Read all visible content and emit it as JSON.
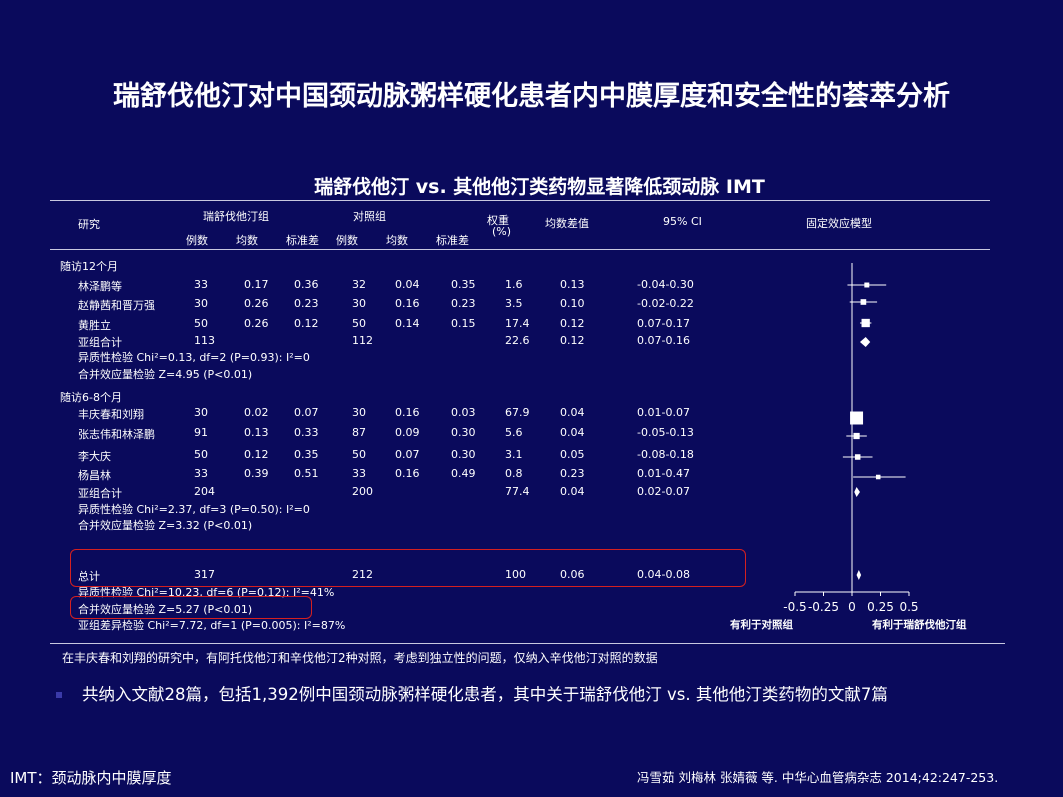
{
  "title": "瑞舒伐他汀对中国颈动脉粥样硬化患者内中膜厚度和安全性的荟萃分析",
  "subtitle": "瑞舒伐他汀 vs. 其他他汀类药物显著降低颈动脉 IMT",
  "table": {
    "col_study": "研究",
    "group1": "瑞舒伐他汀组",
    "group2": "对照组",
    "weight": "权重",
    "weight_unit": "(%)",
    "md": "均数差值",
    "ci": "95% CI",
    "model": "固定效应模型",
    "sub_n1": "例数",
    "sub_mean1": "均数",
    "sub_sd1": "标准差",
    "sub_n2": "例数",
    "sub_mean2": "均数",
    "sub_sd2": "标准差"
  },
  "sections": {
    "s1": "随访12个月",
    "s1_het": "异质性检验 Chi²=0.13, df=2 (P=0.93): I²=0",
    "s1_overall": "合并效应量检验 Z=4.95 (P<0.01)",
    "s2": "随访6-8个月",
    "s2_het": "异质性检验 Chi²=2.37, df=3 (P=0.50): I²=0",
    "s2_overall": "合并效应量检验 Z=3.32 (P<0.01)",
    "total_het": "异质性检验 Chi²=10.23, df=6 (P=0.12): I²=41%",
    "total_overall": "合并效应量检验 Z=5.27 (P<0.01)",
    "subgroup_diff": "亚组差异检验 Chi²=7.72, df=1 (P=0.005): I²=87%"
  },
  "chart_data": {
    "type": "forest",
    "rows": [
      {
        "study": "林泽鹏等",
        "n1": "33",
        "m1": "0.17",
        "sd1": "0.36",
        "n2": "32",
        "m2": "0.04",
        "sd2": "0.35",
        "w": "1.6",
        "md": "0.13",
        "ci": "-0.04-0.30",
        "est": 0.13,
        "lo": -0.04,
        "hi": 0.3,
        "kind": "study"
      },
      {
        "study": "赵静茜和晋万强",
        "n1": "30",
        "m1": "0.26",
        "sd1": "0.23",
        "n2": "30",
        "m2": "0.16",
        "sd2": "0.23",
        "w": "3.5",
        "md": "0.10",
        "ci": "-0.02-0.22",
        "est": 0.1,
        "lo": -0.02,
        "hi": 0.22,
        "kind": "study"
      },
      {
        "study": "黄胜立",
        "n1": "50",
        "m1": "0.26",
        "sd1": "0.12",
        "n2": "50",
        "m2": "0.14",
        "sd2": "0.15",
        "w": "17.4",
        "md": "0.12",
        "ci": "0.07-0.17",
        "est": 0.12,
        "lo": 0.07,
        "hi": 0.17,
        "kind": "study"
      },
      {
        "study": "亚组合计",
        "n1": "113",
        "m1": "",
        "sd1": "",
        "n2": "112",
        "m2": "",
        "sd2": "",
        "w": "22.6",
        "md": "0.12",
        "ci": "0.07-0.16",
        "est": 0.12,
        "lo": 0.07,
        "hi": 0.16,
        "kind": "subtotal"
      },
      {
        "study": "丰庆春和刘翔",
        "n1": "30",
        "m1": "0.02",
        "sd1": "0.07",
        "n2": "30",
        "m2": "0.16",
        "sd2": "0.03",
        "w": "67.9",
        "md": "0.04",
        "ci": "0.01-0.07",
        "est": 0.04,
        "lo": 0.01,
        "hi": 0.07,
        "kind": "study"
      },
      {
        "study": "张志伟和林泽鹏",
        "n1": "91",
        "m1": "0.13",
        "sd1": "0.33",
        "n2": "87",
        "m2": "0.09",
        "sd2": "0.30",
        "w": "5.6",
        "md": "0.04",
        "ci": "-0.05-0.13",
        "est": 0.04,
        "lo": -0.05,
        "hi": 0.13,
        "kind": "study"
      },
      {
        "study": "李大庆",
        "n1": "50",
        "m1": "0.12",
        "sd1": "0.35",
        "n2": "50",
        "m2": "0.07",
        "sd2": "0.30",
        "w": "3.1",
        "md": "0.05",
        "ci": "-0.08-0.18",
        "est": 0.05,
        "lo": -0.08,
        "hi": 0.18,
        "kind": "study"
      },
      {
        "study": "杨昌林",
        "n1": "33",
        "m1": "0.39",
        "sd1": "0.51",
        "n2": "33",
        "m2": "0.16",
        "sd2": "0.49",
        "w": "0.8",
        "md": "0.23",
        "ci": "0.01-0.47",
        "est": 0.23,
        "lo": 0.01,
        "hi": 0.47,
        "kind": "study"
      },
      {
        "study": "亚组合计",
        "n1": "204",
        "m1": "",
        "sd1": "",
        "n2": "200",
        "m2": "",
        "sd2": "",
        "w": "77.4",
        "md": "0.04",
        "ci": "0.02-0.07",
        "est": 0.04,
        "lo": 0.02,
        "hi": 0.07,
        "kind": "subtotal"
      },
      {
        "study": "总计",
        "n1": "317",
        "m1": "",
        "sd1": "",
        "n2": "212",
        "m2": "",
        "sd2": "",
        "w": "100",
        "md": "0.06",
        "ci": "0.04-0.08",
        "est": 0.06,
        "lo": 0.04,
        "hi": 0.08,
        "kind": "total"
      }
    ],
    "x_ticks": [
      "-0.5",
      "-0.25",
      "0",
      "0.25",
      "0.5"
    ],
    "x_tick_values": [
      -0.5,
      -0.25,
      0,
      0.25,
      0.5
    ],
    "xlim": [
      -0.5,
      0.5
    ],
    "favors_left": "有利于对照组",
    "favors_right": "有利于瑞舒伐他汀组"
  },
  "footnote": "在丰庆春和刘翔的研究中，有阿托伐他汀和辛伐他汀2种对照，考虑到独立性的问题，仅纳入辛伐他汀对照的数据",
  "bullet": "共纳入文献28篇，包括1,392例中国颈动脉粥样硬化患者，其中关于瑞舒伐他汀 vs. 其他他汀类药物的文献7篇",
  "imt_note": "IMT：颈动脉内中膜厚度",
  "citation": "冯雪茹 刘梅林 张婧薇 等. 中华心血管病杂志 2014;42:247-253.",
  "colors": {
    "background": "#0a0a5c",
    "highlight": "#d42020",
    "text": "#ffffff"
  }
}
